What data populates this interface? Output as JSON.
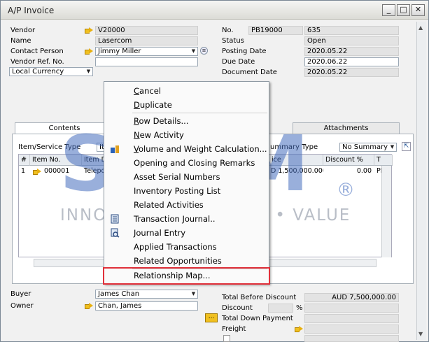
{
  "window": {
    "title": "A/P Invoice",
    "buttons": [
      "_",
      "□",
      "✕"
    ]
  },
  "header_left": {
    "vendor_label": "Vendor",
    "vendor_value": "V20000",
    "name_label": "Name",
    "name_value": "Lasercom",
    "contact_label": "Contact Person",
    "contact_value": "Jimmy Miller",
    "ref_label": "Vendor Ref. No.",
    "ref_value": "",
    "currency_value": "Local Currency"
  },
  "header_right": {
    "no_label": "No.",
    "no_series": "PB19000",
    "no_value": "635",
    "status_label": "Status",
    "status_value": "Open",
    "posting_label": "Posting Date",
    "posting_value": "2020.05.22",
    "due_label": "Due Date",
    "due_value": "2020.06.22",
    "docdate_label": "Document Date",
    "docdate_value": "2020.05.22"
  },
  "tabs": {
    "contents": "Contents",
    "attachments": "Attachments"
  },
  "panel": {
    "item_type_label": "Item/Service Type",
    "item_type_value": "It",
    "summary_type_label": "ummary Type",
    "summary_type_value": "No Summary"
  },
  "grid": {
    "headers": [
      "#",
      "Item No.",
      "Item D",
      "ice",
      "Discount %",
      "T"
    ],
    "row": {
      "num": "1",
      "item_no": "000001",
      "desc": "Telepor",
      "price": "D 1,500,000.000",
      "discount": "0.00",
      "tax": "PI"
    }
  },
  "context_menu": {
    "items": [
      {
        "label": "Cancel",
        "u": "C",
        "rest": "ancel"
      },
      {
        "label": "Duplicate",
        "u": "D",
        "rest": "uplicate"
      },
      {
        "label": "Row Details...",
        "u": "R",
        "rest": "ow Details..."
      },
      {
        "label": "New Activity",
        "u": "N",
        "rest": "ew Activity"
      },
      {
        "label": "Volume and Weight Calculation...",
        "u": "V",
        "rest": "olume and Weight Calculation..."
      },
      {
        "label": "Opening and Closing Remarks",
        "u": "",
        "rest": "Opening and Closing Remarks"
      },
      {
        "label": "Asset Serial Numbers",
        "u": "",
        "rest": "Asset Serial Numbers"
      },
      {
        "label": "Inventory Posting List",
        "u": "",
        "rest": "Inventory Posting List"
      },
      {
        "label": "Related Activities",
        "u": "",
        "rest": "Related Activities"
      },
      {
        "label": "Transaction Journal..",
        "u": "",
        "rest": "Transaction Journal.."
      },
      {
        "label": "Journal Entry",
        "u": "",
        "rest": "Journal Entry"
      },
      {
        "label": "Applied Transactions",
        "u": "",
        "rest": "Applied Transactions"
      },
      {
        "label": "Related Opportunities",
        "u": "",
        "rest": "Related Opportunities"
      },
      {
        "label": "Relationship Map...",
        "u": "",
        "rest": "Relationship Map..."
      }
    ]
  },
  "watermark": {
    "big": "STEM",
    "reg": "®",
    "sub": "INNOVATION • DESIGN • VALUE"
  },
  "footer_left": {
    "buyer_label": "Buyer",
    "buyer_value": "James Chan",
    "owner_label": "Owner",
    "owner_value": "Chan, James"
  },
  "footer_right": {
    "total_before_label": "Total Before Discount",
    "total_before_value": "AUD 7,500,000.00",
    "discount_label": "Discount",
    "discount_pct": "%",
    "down_payment_button": "...",
    "down_payment_label": "Total Down Payment",
    "freight_label": "Freight"
  }
}
